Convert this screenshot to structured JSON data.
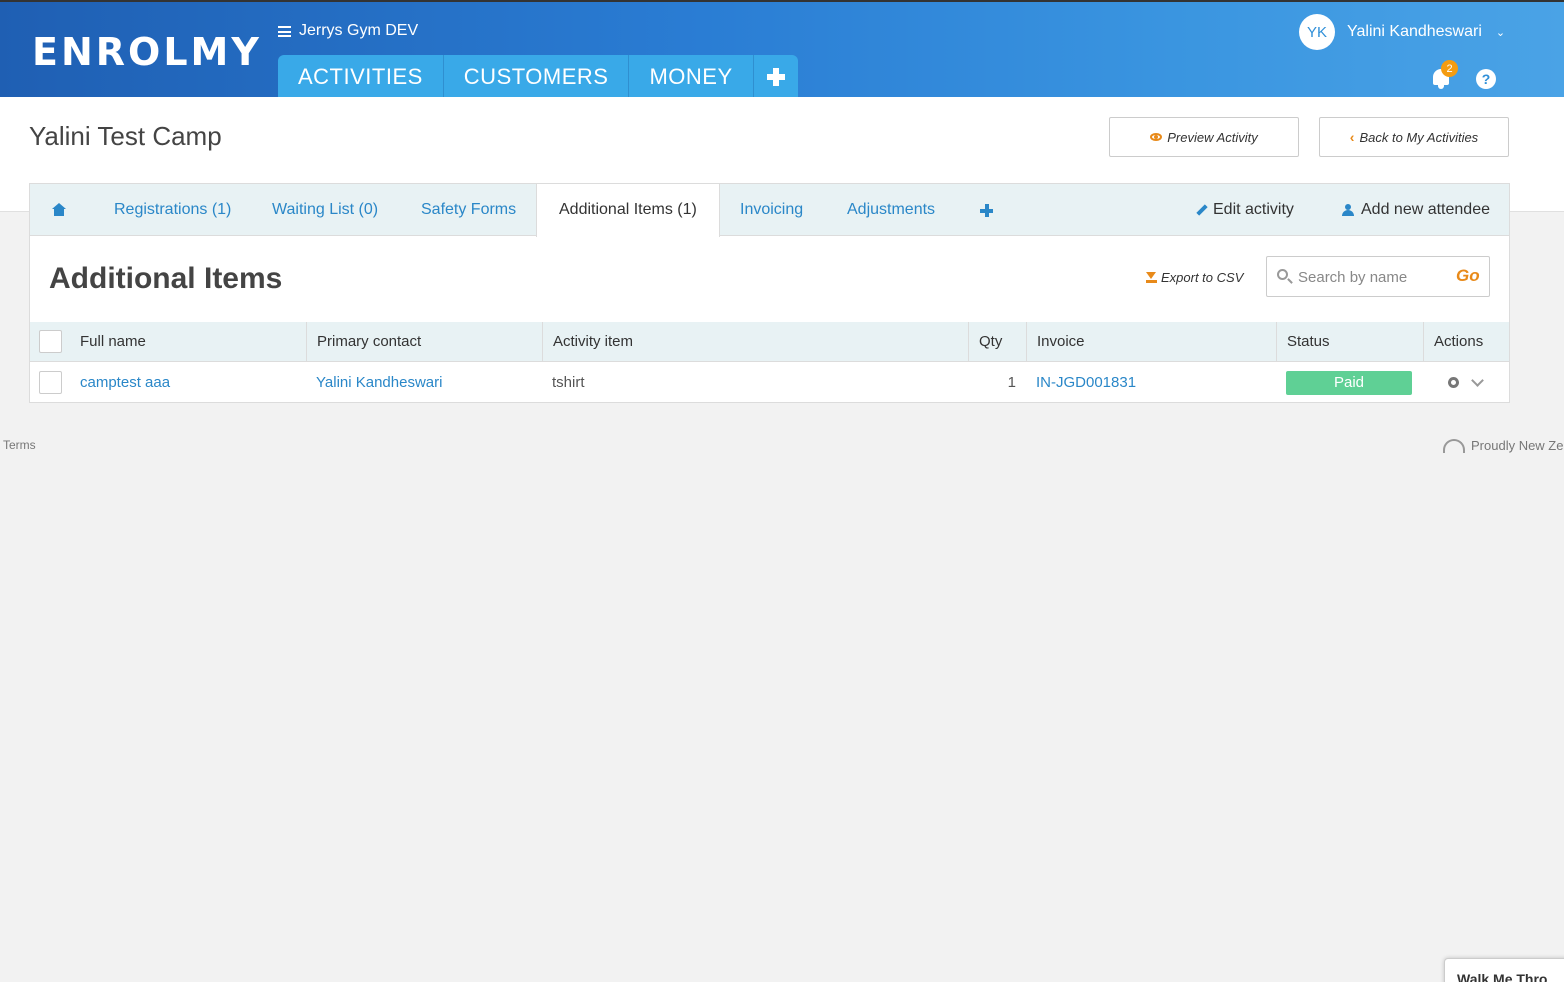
{
  "header": {
    "logo": "ENROLMY",
    "org_name": "Jerrys Gym DEV",
    "nav": [
      "ACTIVITIES",
      "CUSTOMERS",
      "MONEY"
    ],
    "user_initials": "YK",
    "user_name": "Yalini Kandheswari",
    "notification_count": "2",
    "help_label": "?"
  },
  "page": {
    "title": "Yalini Test Camp",
    "preview_button": "Preview Activity",
    "back_button": "Back to My Activities"
  },
  "tabs": {
    "registrations": "Registrations (1)",
    "waiting_list": "Waiting List (0)",
    "safety_forms": "Safety Forms",
    "additional_items": "Additional Items (1)",
    "invoicing": "Invoicing",
    "adjustments": "Adjustments",
    "edit_activity": "Edit activity",
    "add_attendee": "Add new attendee"
  },
  "section": {
    "title": "Additional Items",
    "export_label": "Export to CSV",
    "search_placeholder": "Search by name",
    "search_go": "Go"
  },
  "table": {
    "columns": {
      "full_name": "Full name",
      "primary_contact": "Primary contact",
      "activity_item": "Activity item",
      "qty": "Qty",
      "invoice": "Invoice",
      "status": "Status",
      "actions": "Actions"
    },
    "rows": [
      {
        "full_name": "camptest aaa",
        "primary_contact": "Yalini Kandheswari",
        "activity_item": "tshirt",
        "qty": "1",
        "invoice": "IN-JGD001831",
        "status": "Paid"
      }
    ]
  },
  "footer": {
    "terms": "Terms",
    "proudly": "Proudly New Ze",
    "walkme": "Walk Me Thro"
  },
  "colors": {
    "header_blue": "#2a7dd4",
    "nav_tab_blue": "#39a9e8",
    "link_blue": "#2a87c8",
    "accent_orange": "#e88a1a",
    "status_paid_green": "#5fd095"
  }
}
